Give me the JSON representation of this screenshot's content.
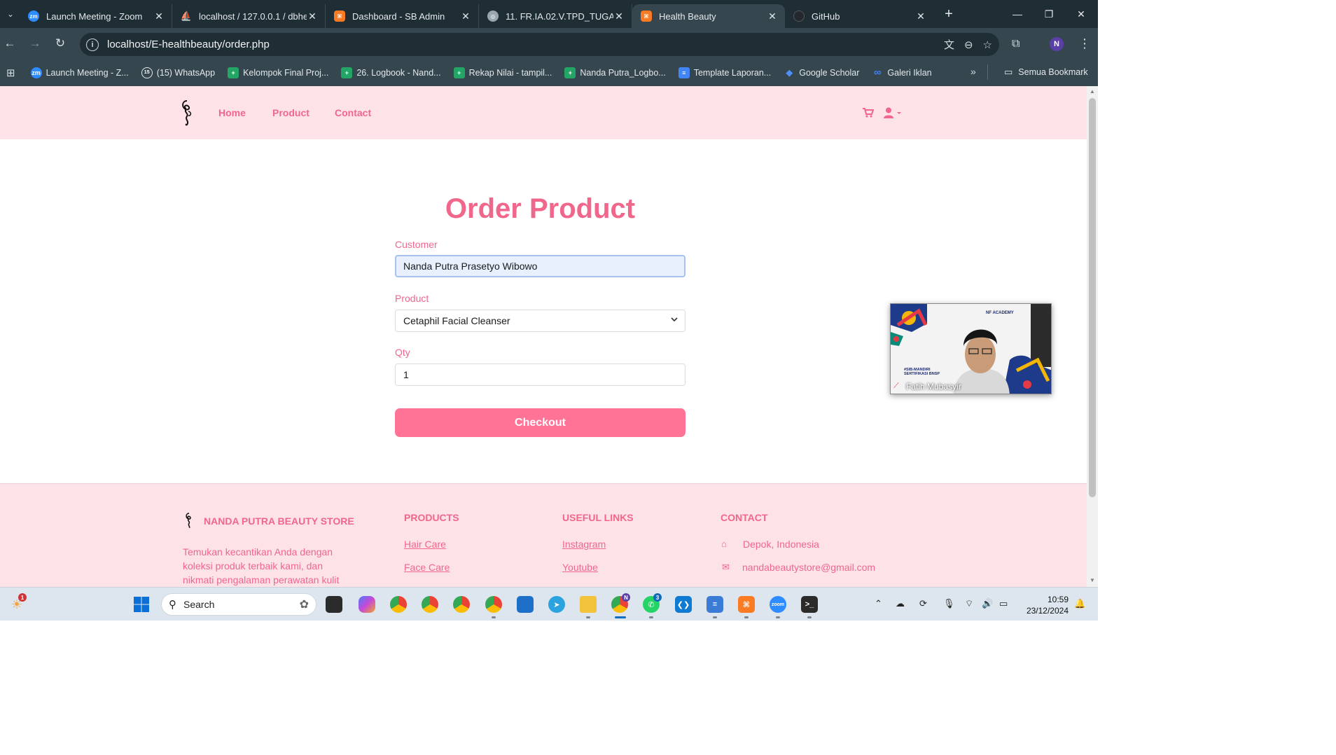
{
  "browser": {
    "tabs": [
      {
        "title": "Launch Meeting - Zoom",
        "icon": "zoom-icon",
        "color": "#2d8cff",
        "badge": "zm"
      },
      {
        "title": "localhost / 127.0.0.1 / dbhe",
        "icon": "phpmyadmin-icon",
        "color": "#f0a030",
        "badge": ""
      },
      {
        "title": "Dashboard - SB Admin",
        "icon": "xampp-icon",
        "color": "#fb7a24",
        "badge": ""
      },
      {
        "title": "11. FR.IA.02.V.TPD_TUGAS",
        "icon": "globe-icon",
        "color": "#9aa7ae",
        "badge": ""
      },
      {
        "title": "Health Beauty",
        "icon": "xampp-icon",
        "color": "#fb7a24",
        "badge": ""
      },
      {
        "title": "GitHub",
        "icon": "github-icon",
        "color": "#24292f",
        "badge": ""
      }
    ],
    "url": "localhost/E-healthbeauty/order.php",
    "profile_initial": "N",
    "bookmarks": [
      {
        "label": "Launch Meeting - Z...",
        "color": "#2d8cff",
        "badge": "zm"
      },
      {
        "label": "(15) WhatsApp",
        "color": "#25d366",
        "badge": "15"
      },
      {
        "label": "Kelompok Final Proj...",
        "color": "#23a566",
        "badge": "+"
      },
      {
        "label": "26. Logbook - Nand...",
        "color": "#23a566",
        "badge": "+"
      },
      {
        "label": "Rekap Nilai - tampil...",
        "color": "#23a566",
        "badge": "+"
      },
      {
        "label": "Nanda Putra_Logbo...",
        "color": "#23a566",
        "badge": "+"
      },
      {
        "label": "Template Laporan...",
        "color": "#4285f4",
        "badge": "≡"
      },
      {
        "label": "Google Scholar",
        "color": "#4285f4",
        "badge": "◆"
      },
      {
        "label": "Galeri Iklan",
        "color": "#0866ff",
        "badge": "∞"
      }
    ],
    "all_bookmarks": "Semua Bookmark"
  },
  "nav": {
    "links": [
      "Home",
      "Product",
      "Contact"
    ]
  },
  "order": {
    "title": "Order Product",
    "customer_label": "Customer",
    "customer_value": "Nanda Putra Prasetyo Wibowo",
    "product_label": "Product",
    "product_value": "Cetaphil Facial Cleanser",
    "qty_label": "Qty",
    "qty_value": "1",
    "checkout_label": "Checkout"
  },
  "footer": {
    "brand": "NANDA PUTRA BEAUTY STORE",
    "description": "Temukan kecantikan Anda dengan koleksi produk terbaik kami, dan nikmati pengalaman perawatan kulit",
    "products_heading": "PRODUCTS",
    "products": [
      "Hair Care",
      "Face Care"
    ],
    "links_heading": "USEFUL LINKS",
    "links": [
      "Instagram",
      "Youtube"
    ],
    "contact_heading": "CONTACT",
    "location": "Depok, Indonesia",
    "email": "nandabeautystore@gmail.com"
  },
  "zoom_overlay": {
    "participant": "Fatih Mubasyir",
    "brand": "NF ACADEMY",
    "tag": "#SIB-MANDIRI SERTIFIKASI BNSP"
  },
  "taskbar": {
    "search_placeholder": "Search",
    "time": "10:59",
    "date": "23/12/2024",
    "notification_count": "1",
    "whatsapp_count": "3",
    "chrome_profile": "N"
  }
}
